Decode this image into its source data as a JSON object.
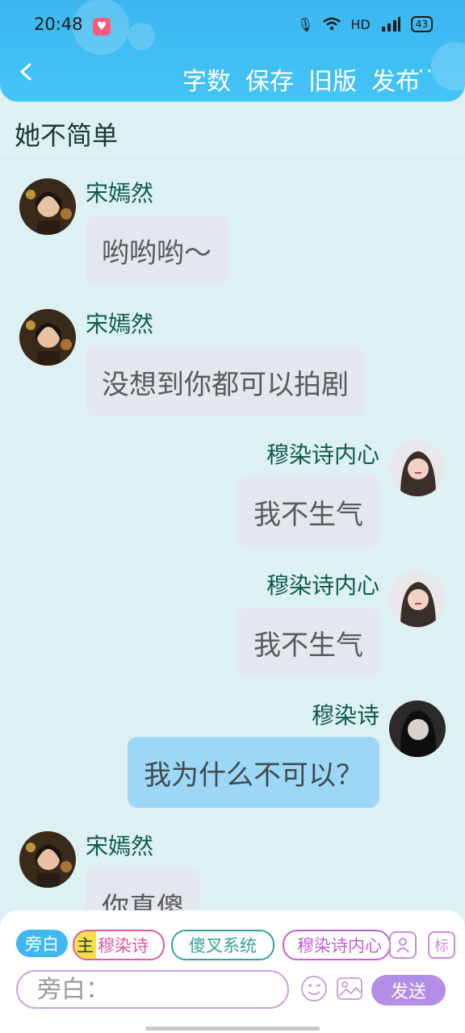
{
  "status": {
    "time": "20:48",
    "network": "HD",
    "battery": "43"
  },
  "nav": {
    "actions": [
      "字数",
      "保存",
      "旧版",
      "发布"
    ],
    "more": "···"
  },
  "page": {
    "title": "她不简单"
  },
  "messages": [
    {
      "side": "left",
      "name": "宋嫣然",
      "text": "哟哟哟～",
      "style": "gray"
    },
    {
      "side": "left",
      "name": "宋嫣然",
      "text": "没想到你都可以拍剧",
      "style": "gray"
    },
    {
      "side": "right",
      "name": "穆染诗内心",
      "text": "我不生气",
      "style": "gray"
    },
    {
      "side": "right",
      "name": "穆染诗内心",
      "text": "我不生气",
      "style": "gray"
    },
    {
      "side": "right",
      "name": "穆染诗",
      "text": "我为什么不可以？",
      "style": "blue"
    },
    {
      "side": "left",
      "name": "宋嫣然",
      "text": "你真傻",
      "style": "gray"
    }
  ],
  "composer": {
    "chips": {
      "narration": "旁白",
      "main_badge": "主",
      "main_name": "穆染诗",
      "system": "傻叉系统",
      "inner": "穆染诗内心"
    },
    "tag_icon_label": "标",
    "placeholder": "旁白：",
    "send_label": "发送"
  },
  "colors": {
    "accent": "#43c4f6",
    "send": "#b38ee8",
    "name": "#0f5b4b"
  }
}
